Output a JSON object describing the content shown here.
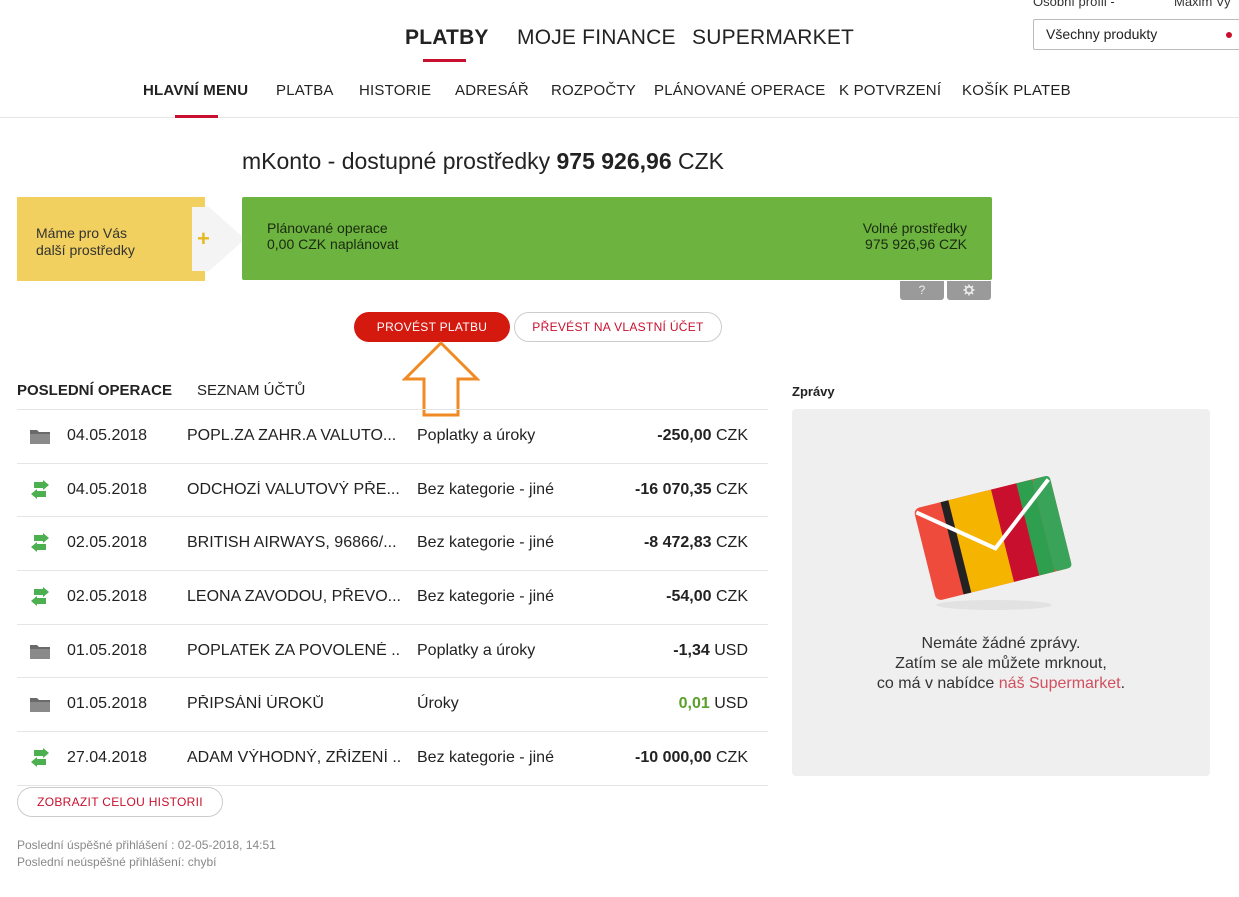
{
  "top_nav": {
    "tabs": [
      {
        "label": "PLATBY",
        "active": true
      },
      {
        "label": "MOJE FINANCE",
        "active": false
      },
      {
        "label": "SUPERMARKET",
        "active": false
      }
    ]
  },
  "profile": {
    "label": "Osobní profil -",
    "user": "Maxim Vy",
    "select_value": "Všechny produkty"
  },
  "sub_nav": {
    "items": [
      "HLAVNÍ MENU",
      "PLATBA",
      "HISTORIE",
      "ADRESÁŘ",
      "ROZPOČTY",
      "PLÁNOVANÉ OPERACE",
      "K POTVRZENÍ",
      "KOŠÍK PLATEB"
    ],
    "active_index": 0
  },
  "account": {
    "title_prefix": "mKonto - dostupné prostředky ",
    "balance": "975 926,96",
    "currency": " CZK"
  },
  "promo": {
    "line1": "Máme pro Vás",
    "line2": "další prostředky",
    "icon": "plus-icon"
  },
  "green_box": {
    "planned_label": "Plánované operace",
    "planned_value": "0,00 CZK naplánovat",
    "free_label": "Volné prostředky",
    "free_value": "975 926,96 CZK",
    "help_label": "?",
    "settings_icon": "gear-icon"
  },
  "actions": {
    "primary": "PROVÉST PLATBU",
    "secondary": "PŘEVÉST NA VLASTNÍ ÚČET"
  },
  "ops_tabs": [
    "POSLEDNÍ OPERACE",
    "SEZNAM ÚČTŮ"
  ],
  "operations": [
    {
      "icon": "folder-icon",
      "date": "04.05.2018",
      "desc": "POPL.ZA ZAHR.A VALUTO...",
      "category": "Poplatky a úroky",
      "amount": "-250,00",
      "currency": " CZK",
      "positive": false
    },
    {
      "icon": "transfer-icon",
      "date": "04.05.2018",
      "desc": "ODCHOZÍ VALUTOVÝ PŘE...",
      "category": "Bez kategorie - jiné",
      "amount": "-16 070,35",
      "currency": " CZK",
      "positive": false
    },
    {
      "icon": "transfer-icon",
      "date": "02.05.2018",
      "desc": "BRITISH AIRWAYS, 96866/...",
      "category": "Bez kategorie - jiné",
      "amount": "-8 472,83",
      "currency": " CZK",
      "positive": false
    },
    {
      "icon": "transfer-icon",
      "date": "02.05.2018",
      "desc": "LEONA ZAVODOU, PŘEVO...",
      "category": "Bez kategorie - jiné",
      "amount": "-54,00",
      "currency": " CZK",
      "positive": false
    },
    {
      "icon": "folder-icon",
      "date": "01.05.2018",
      "desc": "POPLATEK ZA POVOLENÉ ...",
      "category": "Poplatky a úroky",
      "amount": "-1,34",
      "currency": " USD",
      "positive": false
    },
    {
      "icon": "folder-icon",
      "date": "01.05.2018",
      "desc": "PŘIPSÁNÍ ÚROKŮ",
      "category": "Úroky",
      "amount": "0,01",
      "currency": " USD",
      "positive": true
    },
    {
      "icon": "transfer-icon",
      "date": "27.04.2018",
      "desc": "ADAM VÝHODNÝ, ZŘÍZENÍ ...",
      "category": "Bez kategorie - jiné",
      "amount": "-10 000,00",
      "currency": " CZK",
      "positive": false
    }
  ],
  "history_button": "ZOBRAZIT CELOU HISTORII",
  "login_info": {
    "last_success": "Poslední úspěšné přihlášení : 02-05-2018, 14:51",
    "last_fail": "Poslední neúspěšné přihlášení: chybí"
  },
  "messages": {
    "title": "Zprávy",
    "line1": "Nemáte žádné zprávy.",
    "line2": "Zatím se ale můžete mrknout,",
    "line3_prefix": "co má v nabídce ",
    "line3_link": "náš Supermarket",
    "line3_suffix": "."
  },
  "colors": {
    "brand_red": "#c8102e",
    "green_panel": "#6db33f",
    "promo_yellow": "#f2d060",
    "hint_orange": "#f08a24"
  }
}
